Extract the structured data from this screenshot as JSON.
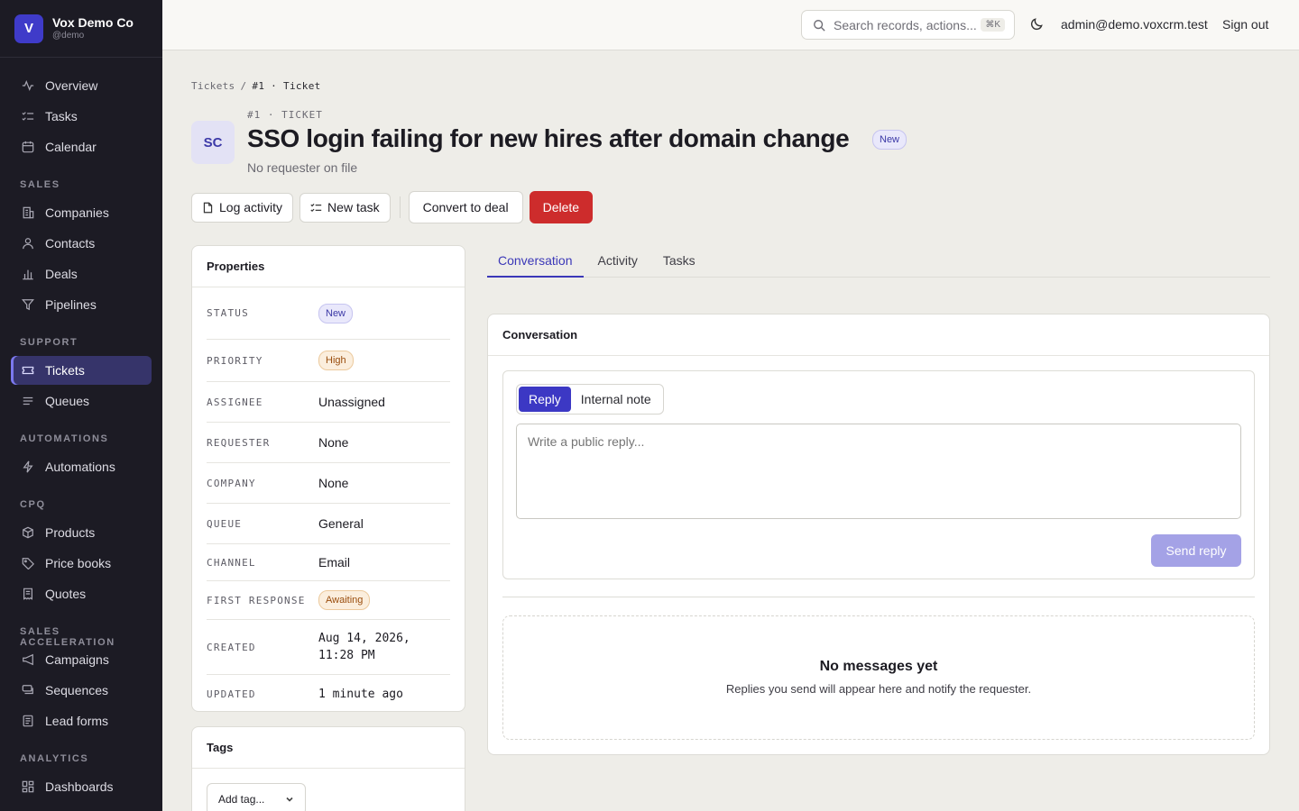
{
  "org": {
    "logo_letter": "V",
    "name": "Vox Demo Co",
    "handle": "@demo"
  },
  "sidebar": {
    "top": [
      {
        "label": "Overview",
        "icon": "activity-icon"
      },
      {
        "label": "Tasks",
        "icon": "checklist-icon"
      },
      {
        "label": "Calendar",
        "icon": "calendar-icon"
      }
    ],
    "sections": [
      {
        "title": "SALES",
        "items": [
          {
            "label": "Companies",
            "icon": "building-icon"
          },
          {
            "label": "Contacts",
            "icon": "user-icon"
          },
          {
            "label": "Deals",
            "icon": "bar-chart-icon"
          },
          {
            "label": "Pipelines",
            "icon": "filter-icon"
          }
        ]
      },
      {
        "title": "SUPPORT",
        "items": [
          {
            "label": "Tickets",
            "icon": "ticket-icon",
            "active": true
          },
          {
            "label": "Queues",
            "icon": "list-icon"
          }
        ]
      },
      {
        "title": "AUTOMATIONS",
        "items": [
          {
            "label": "Automations",
            "icon": "lightning-icon"
          }
        ]
      },
      {
        "title": "CPQ",
        "items": [
          {
            "label": "Products",
            "icon": "box-icon"
          },
          {
            "label": "Price books",
            "icon": "tag-icon"
          },
          {
            "label": "Quotes",
            "icon": "receipt-icon"
          }
        ]
      },
      {
        "title": "SALES ACCELERATION",
        "items": [
          {
            "label": "Campaigns",
            "icon": "megaphone-icon"
          },
          {
            "label": "Sequences",
            "icon": "sequence-icon"
          },
          {
            "label": "Lead forms",
            "icon": "form-icon"
          }
        ]
      },
      {
        "title": "ANALYTICS",
        "items": [
          {
            "label": "Dashboards",
            "icon": "grid-icon"
          }
        ]
      }
    ]
  },
  "topbar": {
    "search_placeholder": "Search records, actions...",
    "search_shortcut": "⌘K",
    "user_email": "admin@demo.voxcrm.test",
    "signout_label": "Sign out"
  },
  "breadcrumb": {
    "root": "Tickets",
    "separator": "/",
    "current": "#1 · Ticket"
  },
  "header": {
    "avatar_initials": "SC",
    "eyebrow": "#1 · TICKET",
    "title": "SSO login failing for new hires after domain change",
    "status_badge": "New",
    "subtitle": "No requester on file"
  },
  "actions": {
    "log_activity": "Log activity",
    "new_task": "New task",
    "convert": "Convert to deal",
    "delete": "Delete"
  },
  "properties": {
    "title": "Properties",
    "status_key": "STATUS",
    "status_val": "New",
    "priority_key": "PRIORITY",
    "priority_val": "High",
    "assignee_key": "ASSIGNEE",
    "assignee_val": "Unassigned",
    "requester_key": "REQUESTER",
    "requester_val": "None",
    "company_key": "COMPANY",
    "company_val": "None",
    "queue_key": "QUEUE",
    "queue_val": "General",
    "channel_key": "CHANNEL",
    "channel_val": "Email",
    "first_response_key": "FIRST RESPONSE",
    "first_response_val": "Awaiting",
    "created_key": "CREATED",
    "created_val_1": "Aug 14, 2026,",
    "created_val_2": "11:28 PM",
    "updated_key": "UPDATED",
    "updated_val": "1 minute ago"
  },
  "tags": {
    "title": "Tags",
    "add_label": "Add tag..."
  },
  "tabs": {
    "conversation": "Conversation",
    "activity": "Activity",
    "tasks": "Tasks"
  },
  "conversation": {
    "title": "Conversation",
    "reply_tab": "Reply",
    "note_tab": "Internal note",
    "reply_placeholder": "Write a public reply...",
    "send_label": "Send reply",
    "empty_title": "No messages yet",
    "empty_sub": "Replies you send will appear here and notify the requester."
  },
  "colors": {
    "accent": "#3c38c4",
    "danger": "#cd2c2c",
    "sidebar_bg": "#1c1b24"
  }
}
